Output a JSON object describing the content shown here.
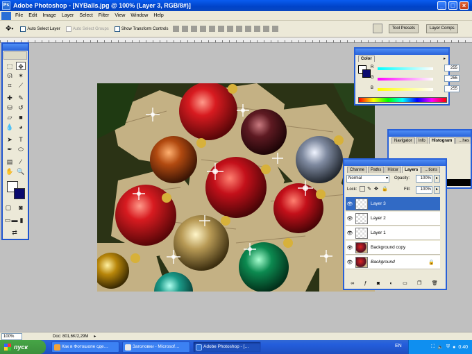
{
  "window": {
    "title": "Adobe Photoshop - [NYBalls.jpg @ 100% (Layer 3, RGB/8#)]"
  },
  "menu": [
    "File",
    "Edit",
    "Image",
    "Layer",
    "Select",
    "Filter",
    "View",
    "Window",
    "Help"
  ],
  "options": {
    "auto_select_layer": "Auto Select Layer",
    "auto_select_groups": "Auto Select Groups",
    "show_transform_controls": "Show Transform Controls",
    "tool_presets": "Tool Presets",
    "layer_comps": "Layer Comps"
  },
  "color_palette": {
    "tab": "Color",
    "r_label": "R",
    "g_label": "G",
    "b_label": "B",
    "r": "255",
    "g": "255",
    "b": "255"
  },
  "navigator_palette": {
    "tabs": [
      "Navigator",
      "Info",
      "Histogram",
      "…hes"
    ]
  },
  "layers_palette": {
    "tabs": [
      "Channe",
      "Paths",
      "Histor",
      "Layers",
      "…tions"
    ],
    "blend_mode": "Normal",
    "opacity_label": "Opacity:",
    "opacity": "100%",
    "lock_label": "Lock:",
    "fill_label": "Fill:",
    "fill": "100%",
    "layers": [
      {
        "name": "Layer 3",
        "selected": true
      },
      {
        "name": "Layer 2",
        "selected": false
      },
      {
        "name": "Layer 1",
        "selected": false
      },
      {
        "name": "Background copy",
        "selected": false
      },
      {
        "name": "Background",
        "selected": false
      }
    ]
  },
  "status": {
    "zoom": "100%",
    "doc": "Doc: 801,6K/2,29M"
  },
  "taskbar": {
    "start": "пуск",
    "tasks": [
      "Как в Фотошопе сде…",
      "Заголовки - Microsof…",
      "Adobe Photoshop - […"
    ],
    "lang": "EN",
    "clock": "0:40"
  },
  "colors": {
    "accent": "#2860d8",
    "selected_layer": "#316ac5"
  }
}
